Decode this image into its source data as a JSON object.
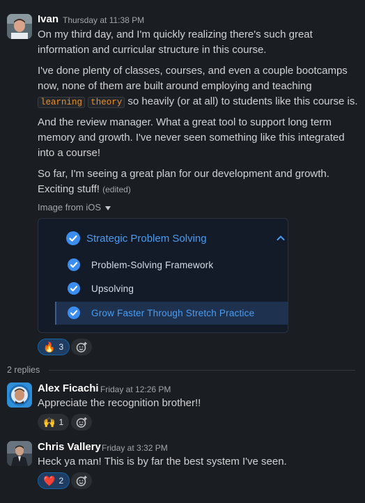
{
  "messages": {
    "ivan": {
      "name": "Ivan",
      "time": "Thursday at 11:38 PM",
      "p1": "On my third day, and I'm quickly realizing there's such great information and curricular structure in this course.",
      "p2_before": "I've done plenty of classes, courses, and even a couple bootcamps now, none of them are built around employing and teaching ",
      "p2_code1": "learning",
      "p2_code2": "theory",
      "p2_after": " so heavily (or at all) to students like this course is.",
      "p3": "And the review manager. What a great tool to support long term memory and growth. I've never seen something like this integrated into a course!",
      "p4": "So far, I'm seeing a great plan for our development and growth. Exciting stuff!",
      "edited": "(edited)",
      "image_label": "Image from iOS",
      "reaction_emoji": "🔥",
      "reaction_count": "3"
    },
    "alex": {
      "name": "Alex Ficachi",
      "time": "Friday at 12:26 PM",
      "text": "Appreciate the recognition brother!!",
      "reaction_emoji": "🙌",
      "reaction_count": "1"
    },
    "chris": {
      "name": "Chris Vallery",
      "time": "Friday at 3:32 PM",
      "text": "Heck ya man! This is by far the best system I've seen.",
      "reaction_emoji": "❤️",
      "reaction_count": "2"
    }
  },
  "attachment": {
    "title": "Strategic Problem Solving",
    "items": [
      "Problem-Solving Framework",
      "Upsolving",
      "Grow Faster Through Stretch Practice"
    ],
    "accent": "#3b8ef0"
  },
  "thread": {
    "replies_label": "2 replies"
  },
  "icons": [
    "check-circle-icon",
    "chevron-up-icon",
    "caret-down-icon",
    "add-reaction-icon"
  ]
}
